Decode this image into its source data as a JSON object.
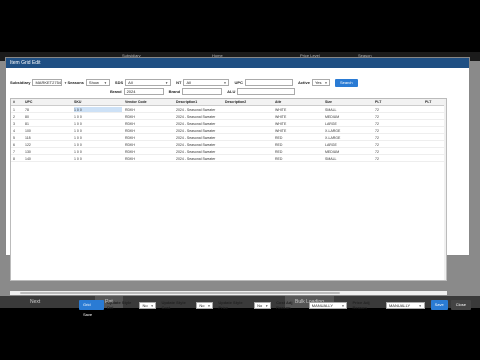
{
  "background": {
    "nav_items": [
      "Subsidiary",
      "Home",
      "Price Level",
      "Season"
    ],
    "mid_buttons": [
      "Clear",
      "Search"
    ],
    "bottom_items": [
      "Next",
      "Ret",
      "Bulk Loading"
    ]
  },
  "modal": {
    "title": "Item Grid Edit",
    "filters": {
      "subsidiary_label": "Subsidiary",
      "subsidiary_value": "MARKET2754",
      "seasons_label": "Seasons",
      "seasons_value": "Show",
      "sds_label": "SDS",
      "sds_value": "All",
      "nt_label": "NT",
      "nt_value": "All",
      "upc_label": "UPC",
      "active_label": "Active",
      "active_value": "Yes",
      "search_label": "Search",
      "brand1_label": "Brand",
      "brand1_value": "2024",
      "brand2_label": "Brand",
      "alu_label": "ALU"
    },
    "grid": {
      "columns": [
        "#",
        "UPC",
        "SKU",
        "Vendor Code",
        "Description1",
        "Description2",
        "Attr",
        "Size",
        "PLT",
        "PLT"
      ],
      "rows": [
        {
          "num": "1",
          "upc": "78",
          "ats": "1 0 0",
          "vendor": "RDKH",
          "desc1": "2024 - Seasonal Sweater",
          "desc2": "",
          "attr": "WHITE",
          "size": "SMALL",
          "plt": "72"
        },
        {
          "num": "2",
          "upc": "80",
          "ats": "1 0 0",
          "vendor": "RDKH",
          "desc1": "2024 - Seasonal Sweater",
          "desc2": "",
          "attr": "WHITE",
          "size": "MEDIUM",
          "plt": "72"
        },
        {
          "num": "3",
          "upc": "81",
          "ats": "1 0 0",
          "vendor": "RDKH",
          "desc1": "2024 - Seasonal Sweater",
          "desc2": "",
          "attr": "WHITE",
          "size": "LARGE",
          "plt": "72"
        },
        {
          "num": "4",
          "upc": "100",
          "ats": "1 0 0",
          "vendor": "RDKH",
          "desc1": "2024 - Seasonal Sweater",
          "desc2": "",
          "attr": "WHITE",
          "size": "X-LARGE",
          "plt": "72"
        },
        {
          "num": "5",
          "upc": "118",
          "ats": "1 0 0",
          "vendor": "RDKH",
          "desc1": "2024 - Seasonal Sweater",
          "desc2": "",
          "attr": "RED",
          "size": "X-LARGE",
          "plt": "72"
        },
        {
          "num": "6",
          "upc": "122",
          "ats": "1 0 0",
          "vendor": "RDKH",
          "desc1": "2024 - Seasonal Sweater",
          "desc2": "",
          "attr": "RED",
          "size": "LARGE",
          "plt": "72"
        },
        {
          "num": "7",
          "upc": "130",
          "ats": "1 0 0",
          "vendor": "RDKH",
          "desc1": "2024 - Seasonal Sweater",
          "desc2": "",
          "attr": "RED",
          "size": "MEDIUM",
          "plt": "72"
        },
        {
          "num": "8",
          "upc": "140",
          "ats": "1 0 0",
          "vendor": "RDKH",
          "desc1": "2024 - Seasonal Sweater",
          "desc2": "",
          "attr": "RED",
          "size": "SMALL",
          "plt": "72"
        }
      ]
    },
    "footer": {
      "grid_save": "Grid Save",
      "update_style_del_label": "Update Style Del",
      "update_style_del_value": "No",
      "update_style_cost_label": "Update Style Cost",
      "update_style_cost_value": "No",
      "update_style_price_label": "Update Style Price",
      "update_style_price_value": "No",
      "cost_adj_reason_label": "Cost Adj Reason",
      "cost_adj_reason_value": "MANUALLY",
      "price_adj_reason_label": "Price Adj Reason",
      "price_adj_reason_value": "MANUALLY",
      "save": "Save",
      "close": "Close"
    }
  }
}
